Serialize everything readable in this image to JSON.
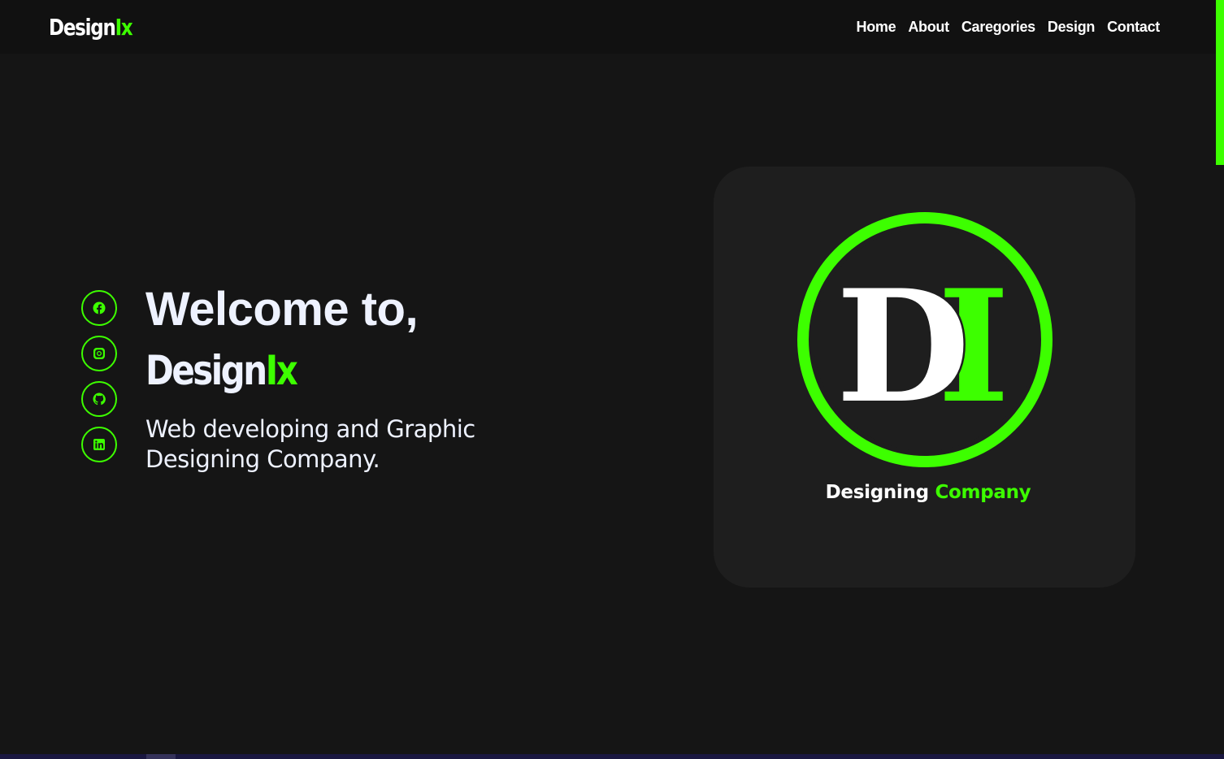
{
  "brand": {
    "name_main": "Design",
    "name_accent": "Ix"
  },
  "nav": {
    "links": [
      "Home",
      "About",
      "Caregories",
      "Design",
      "Contact"
    ]
  },
  "social": {
    "icons": [
      "facebook-icon",
      "instagram-icon",
      "github-icon",
      "linkedin-icon"
    ]
  },
  "hero": {
    "welcome": "Welcome to,",
    "brand_main": "Design",
    "brand_accent": "Ix",
    "tagline": "Web developing and Graphic Designing Company."
  },
  "logo_card": {
    "monogram_main": "D",
    "monogram_accent": "I",
    "caption_main": "Designing",
    "caption_accent": "Company"
  },
  "colors": {
    "accent": "#3dff00",
    "background": "#151515",
    "navbar": "#111111",
    "card": "#1e1e1e",
    "text": "#eef2ff"
  },
  "scrollbar": {
    "position_fraction": 0.0
  }
}
